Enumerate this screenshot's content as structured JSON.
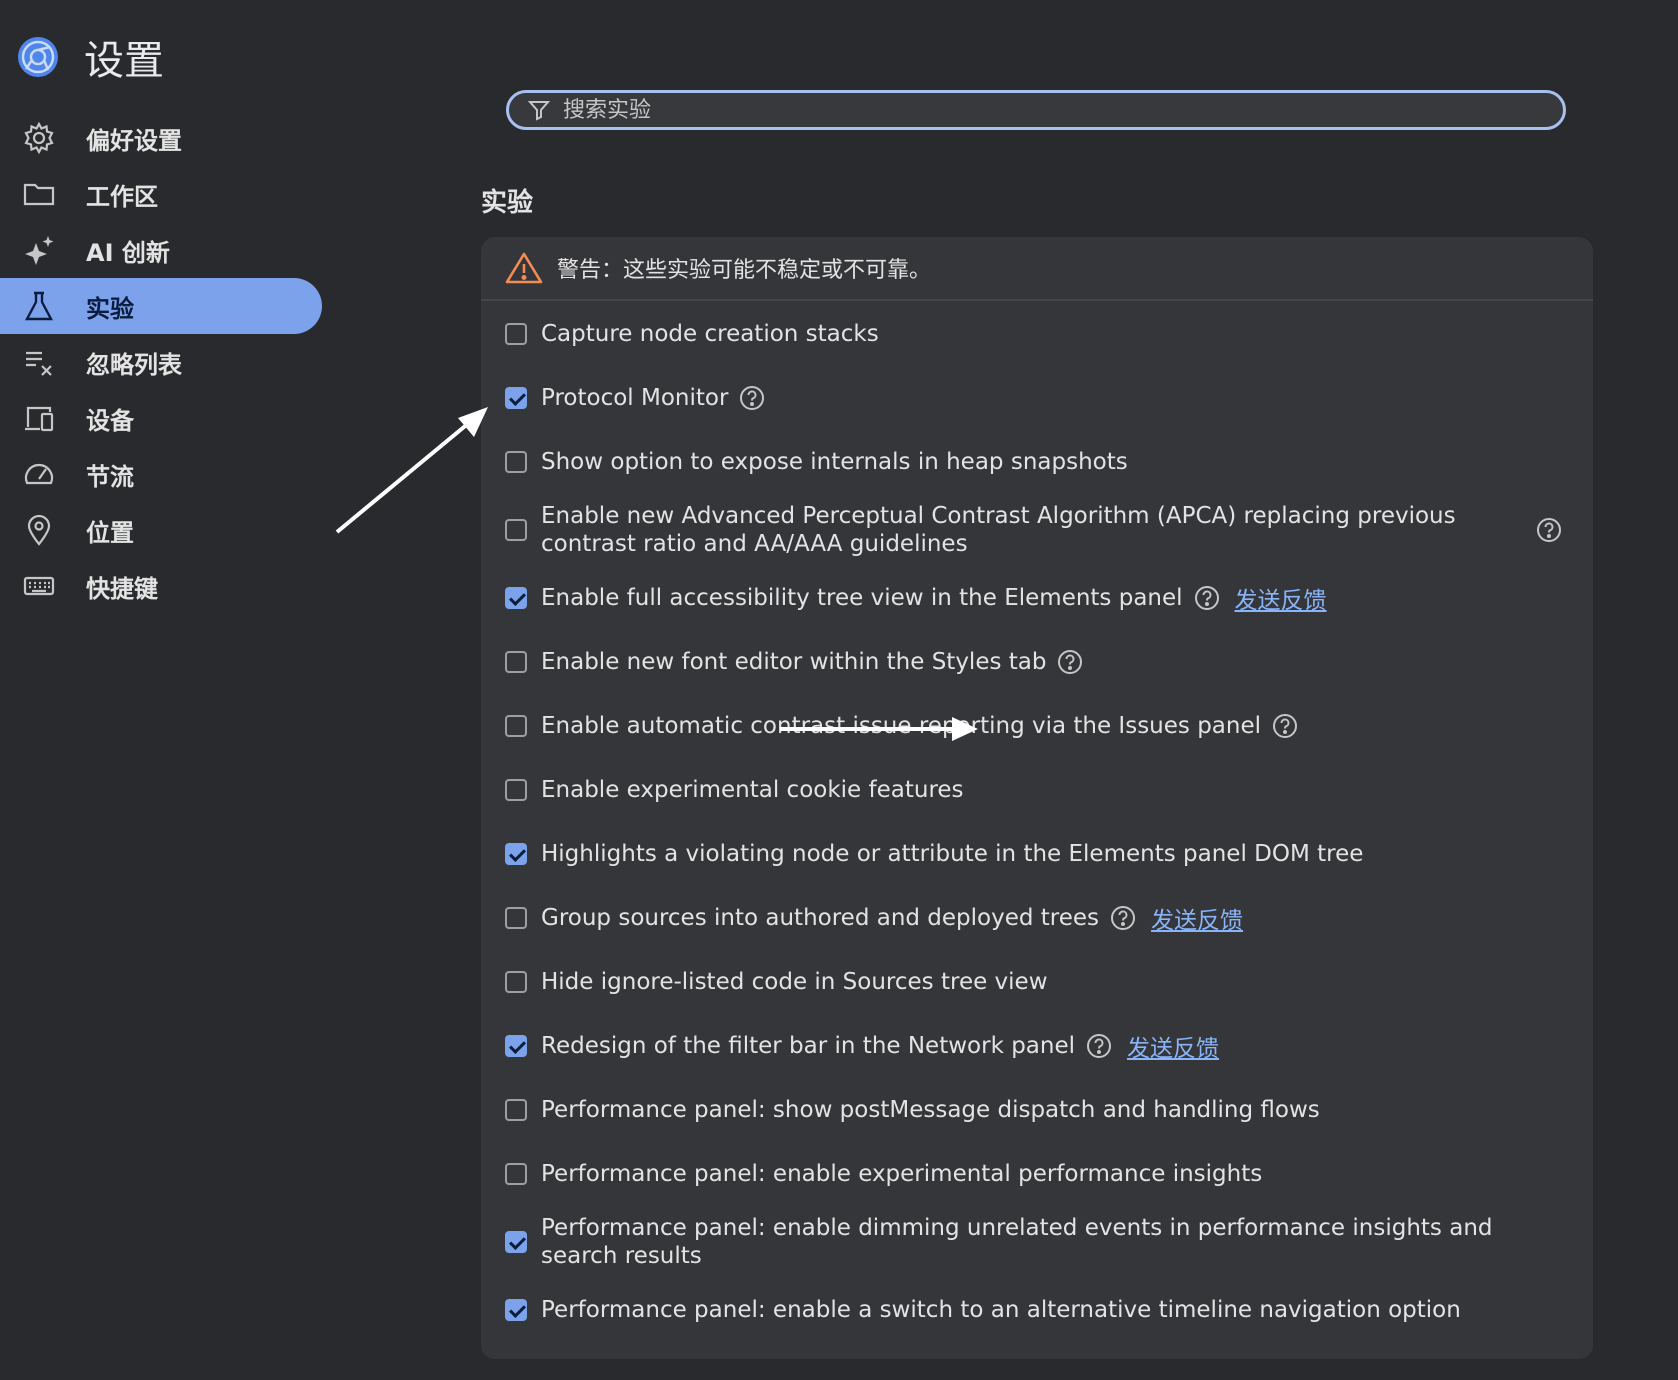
{
  "header": {
    "title": "设置",
    "logo_icon": "chrome-devtools-logo-icon"
  },
  "sidebar": {
    "items": [
      {
        "label": "偏好设置",
        "icon": "gear-icon",
        "active": false
      },
      {
        "label": "工作区",
        "icon": "folder-icon",
        "active": false
      },
      {
        "label": "AI 创新",
        "icon": "sparkle-icon",
        "active": false
      },
      {
        "label": "实验",
        "icon": "flask-icon",
        "active": true
      },
      {
        "label": "忽略列表",
        "icon": "ignore-list-icon",
        "active": false
      },
      {
        "label": "设备",
        "icon": "devices-icon",
        "active": false
      },
      {
        "label": "节流",
        "icon": "speedometer-icon",
        "active": false
      },
      {
        "label": "位置",
        "icon": "location-pin-icon",
        "active": false
      },
      {
        "label": "快捷键",
        "icon": "keyboard-icon",
        "active": false
      }
    ]
  },
  "search": {
    "placeholder": "搜索实验",
    "value": ""
  },
  "section": {
    "title": "实验"
  },
  "warning": {
    "text": "警告：这些实验可能不稳定或不可靠。"
  },
  "experiments": [
    {
      "label": "Capture node creation stacks",
      "checked": false,
      "help": false,
      "feedback": ""
    },
    {
      "label": "Protocol Monitor",
      "checked": true,
      "help": true,
      "feedback": ""
    },
    {
      "label": "Show option to expose internals in heap snapshots",
      "checked": false,
      "help": false,
      "feedback": ""
    },
    {
      "label": "Enable new Advanced Perceptual Contrast Algorithm (APCA) replacing previous contrast ratio and AA/AAA guidelines",
      "checked": false,
      "help": true,
      "feedback": ""
    },
    {
      "label": "Enable full accessibility tree view in the Elements panel",
      "checked": true,
      "help": true,
      "feedback": "发送反馈"
    },
    {
      "label": "Enable new font editor within the Styles tab",
      "checked": false,
      "help": true,
      "feedback": ""
    },
    {
      "label": "Enable automatic contrast issue reporting via the Issues panel",
      "checked": false,
      "help": true,
      "feedback": ""
    },
    {
      "label": "Enable experimental cookie features",
      "checked": false,
      "help": false,
      "feedback": ""
    },
    {
      "label": "Highlights a violating node or attribute in the Elements panel DOM tree",
      "checked": true,
      "help": false,
      "feedback": ""
    },
    {
      "label": "Group sources into authored and deployed trees",
      "checked": false,
      "help": true,
      "feedback": "发送反馈"
    },
    {
      "label": "Hide ignore-listed code in Sources tree view",
      "checked": false,
      "help": false,
      "feedback": ""
    },
    {
      "label": "Redesign of the filter bar in the Network panel",
      "checked": true,
      "help": true,
      "feedback": "发送反馈"
    },
    {
      "label": "Performance panel: show postMessage dispatch and handling flows",
      "checked": false,
      "help": false,
      "feedback": ""
    },
    {
      "label": "Performance panel: enable experimental performance insights",
      "checked": false,
      "help": false,
      "feedback": ""
    },
    {
      "label": "Performance panel: enable dimming unrelated events in performance insights and search results",
      "checked": true,
      "help": false,
      "feedback": ""
    },
    {
      "label": "Performance panel: enable a switch to an alternative timeline navigation option",
      "checked": true,
      "help": false,
      "feedback": ""
    }
  ],
  "colors": {
    "background": "#292a2d",
    "card": "#35363a",
    "accent": "#7ca2ec",
    "link": "#8ab4f8",
    "warning": "#f28b54"
  }
}
